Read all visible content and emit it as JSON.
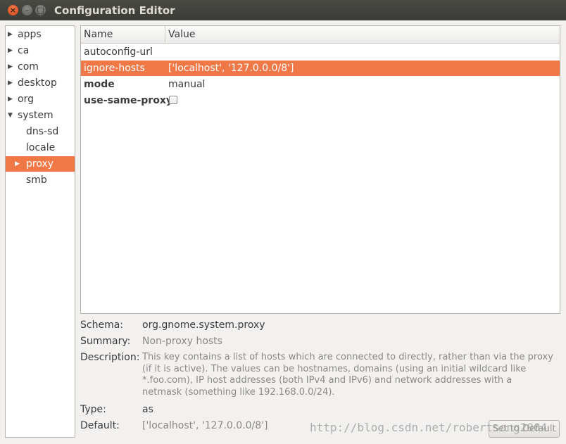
{
  "window": {
    "title": "Configuration Editor",
    "close_glyph": "×",
    "min_glyph": "–",
    "max_glyph": "□"
  },
  "tree": {
    "items": [
      {
        "label": "apps",
        "expander": "right"
      },
      {
        "label": "ca",
        "expander": "right"
      },
      {
        "label": "com",
        "expander": "right"
      },
      {
        "label": "desktop",
        "expander": "right"
      },
      {
        "label": "org",
        "expander": "right"
      },
      {
        "label": "system",
        "expander": "down"
      },
      {
        "label": "dns-sd",
        "expander": "none"
      },
      {
        "label": "locale",
        "expander": "none"
      },
      {
        "label": "proxy",
        "expander": "right",
        "selected": true
      },
      {
        "label": "smb",
        "expander": "none"
      }
    ]
  },
  "keys_table": {
    "columns": [
      "Name",
      "Value"
    ],
    "rows": [
      {
        "name": "autoconfig-url",
        "value": ""
      },
      {
        "name": "ignore-hosts",
        "value": "['localhost', '127.0.0.0/8']",
        "selected": true
      },
      {
        "name": "mode",
        "value": "manual"
      },
      {
        "name": "use-same-proxy",
        "value": "",
        "checkbox": false
      }
    ]
  },
  "details": {
    "schema_label": "Schema:",
    "schema_value": "org.gnome.system.proxy",
    "summary_label": "Summary:",
    "summary_value": "Non-proxy hosts",
    "description_label": "Description:",
    "description_lines": [
      "This key contains a list of hosts which are connected to directly, rather than via the proxy",
      "(if it is active). The values can be hostnames, domains (using an initial wildcard like",
      "*.foo.com), IP host addresses (both IPv4 and IPv6) and network addresses with a",
      "netmask (something like 192.168.0.0/24)."
    ],
    "type_label": "Type:",
    "type_value": "as",
    "default_label": "Default:",
    "default_value": "['localhost', '127.0.0.0/8']"
  },
  "set_default_label": "Set to Default",
  "watermark": "http://blog.csdn.net/robertsong2004"
}
